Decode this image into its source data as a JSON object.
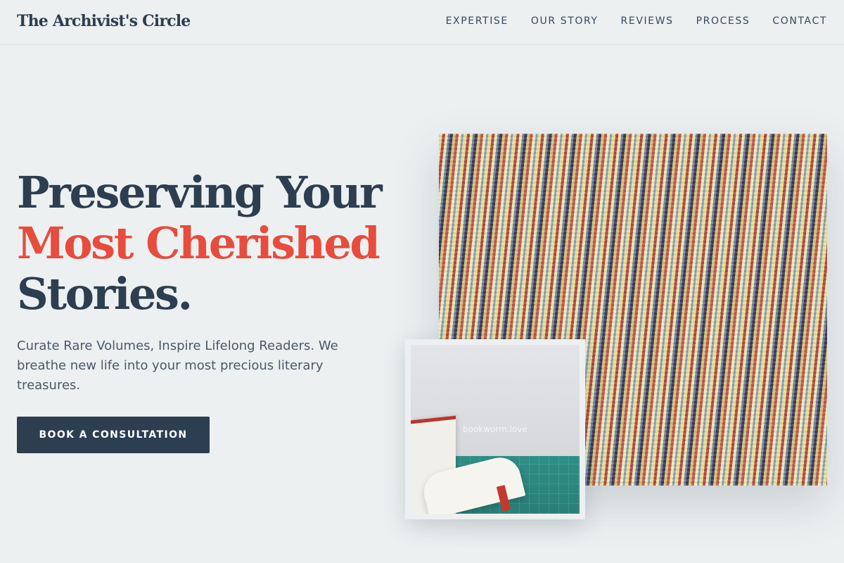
{
  "header": {
    "brand": "The Archivist's Circle",
    "nav": [
      "EXPERTISE",
      "OUR STORY",
      "REVIEWS",
      "PROCESS",
      "CONTACT"
    ]
  },
  "hero": {
    "title_line1": "Preserving Your",
    "title_line2": "Most Cherished",
    "title_line3": "Stories.",
    "subtitle": "Curate Rare Volumes, Inspire Lifelong Readers. We breathe new life into your most precious literary treasures.",
    "cta_label": "BOOK A CONSULTATION"
  },
  "photo": {
    "caption": "bookworm.love"
  },
  "colors": {
    "primary": "#2c3e50",
    "accent": "#e74c3c",
    "background": "#ecf0f1"
  }
}
